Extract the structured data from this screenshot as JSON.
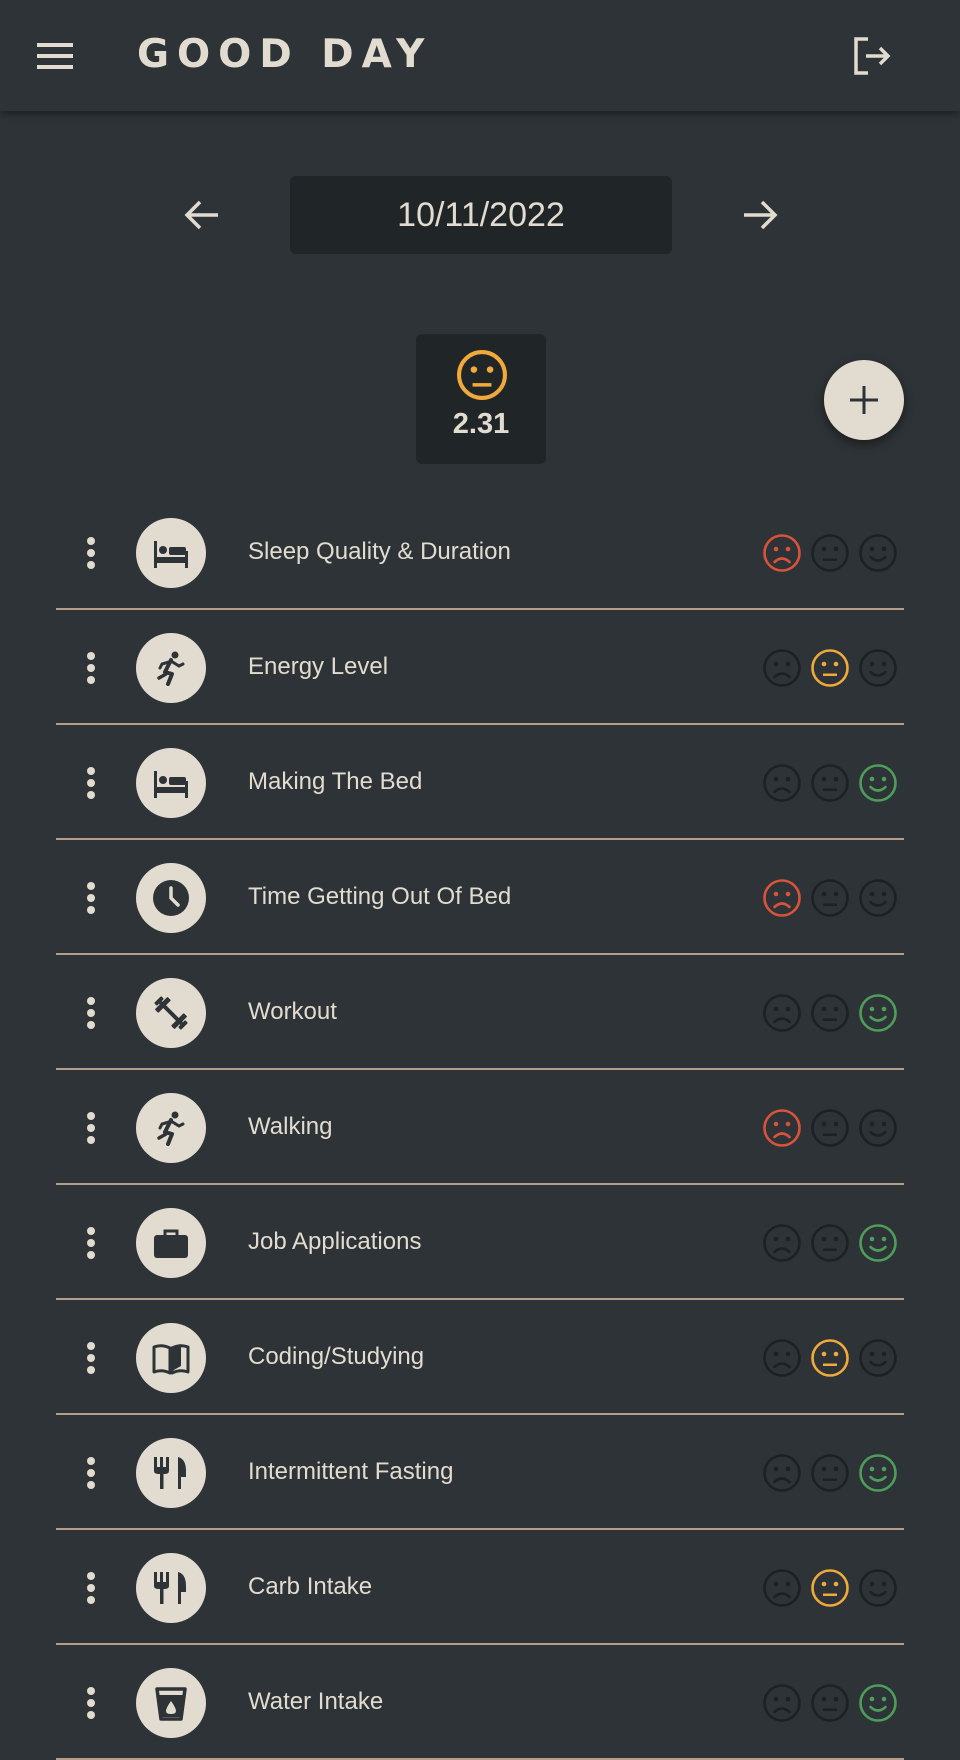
{
  "app": {
    "title": "GOOD DAY",
    "icons": {
      "menu": "menu-icon",
      "logout": "logout-icon"
    }
  },
  "date_nav": {
    "date": "10/11/2022",
    "icons": {
      "prev": "arrow-left-icon",
      "next": "arrow-right-icon"
    }
  },
  "daily_score": {
    "value": "2.31",
    "mood": "neutral",
    "icon": "neutral-face-icon"
  },
  "add_button": {
    "icon": "plus-icon"
  },
  "colors": {
    "background": "#2d3336",
    "surface": "#202628",
    "text": "#e2dcd0",
    "divider": "#b49e8a",
    "bad": "#d9533b",
    "neutral": "#f2a93b",
    "good": "#4e9d5a",
    "inactive": "#1c2123"
  },
  "habits": [
    {
      "label": "Sleep Quality & Duration",
      "icon": "bed-icon",
      "rating": "bad"
    },
    {
      "label": "Energy Level",
      "icon": "running-icon",
      "rating": "neutral"
    },
    {
      "label": "Making The Bed",
      "icon": "bed-icon",
      "rating": "good"
    },
    {
      "label": "Time Getting Out Of Bed",
      "icon": "clock-icon",
      "rating": "bad"
    },
    {
      "label": "Workout",
      "icon": "dumbbell-icon",
      "rating": "good"
    },
    {
      "label": "Walking",
      "icon": "running-icon",
      "rating": "bad"
    },
    {
      "label": "Job Applications",
      "icon": "briefcase-icon",
      "rating": "good"
    },
    {
      "label": "Coding/Studying",
      "icon": "book-icon",
      "rating": "neutral"
    },
    {
      "label": "Intermittent Fasting",
      "icon": "utensils-icon",
      "rating": "good"
    },
    {
      "label": "Carb Intake",
      "icon": "utensils-icon",
      "rating": "neutral"
    },
    {
      "label": "Water Intake",
      "icon": "water-glass-icon",
      "rating": "good"
    }
  ]
}
